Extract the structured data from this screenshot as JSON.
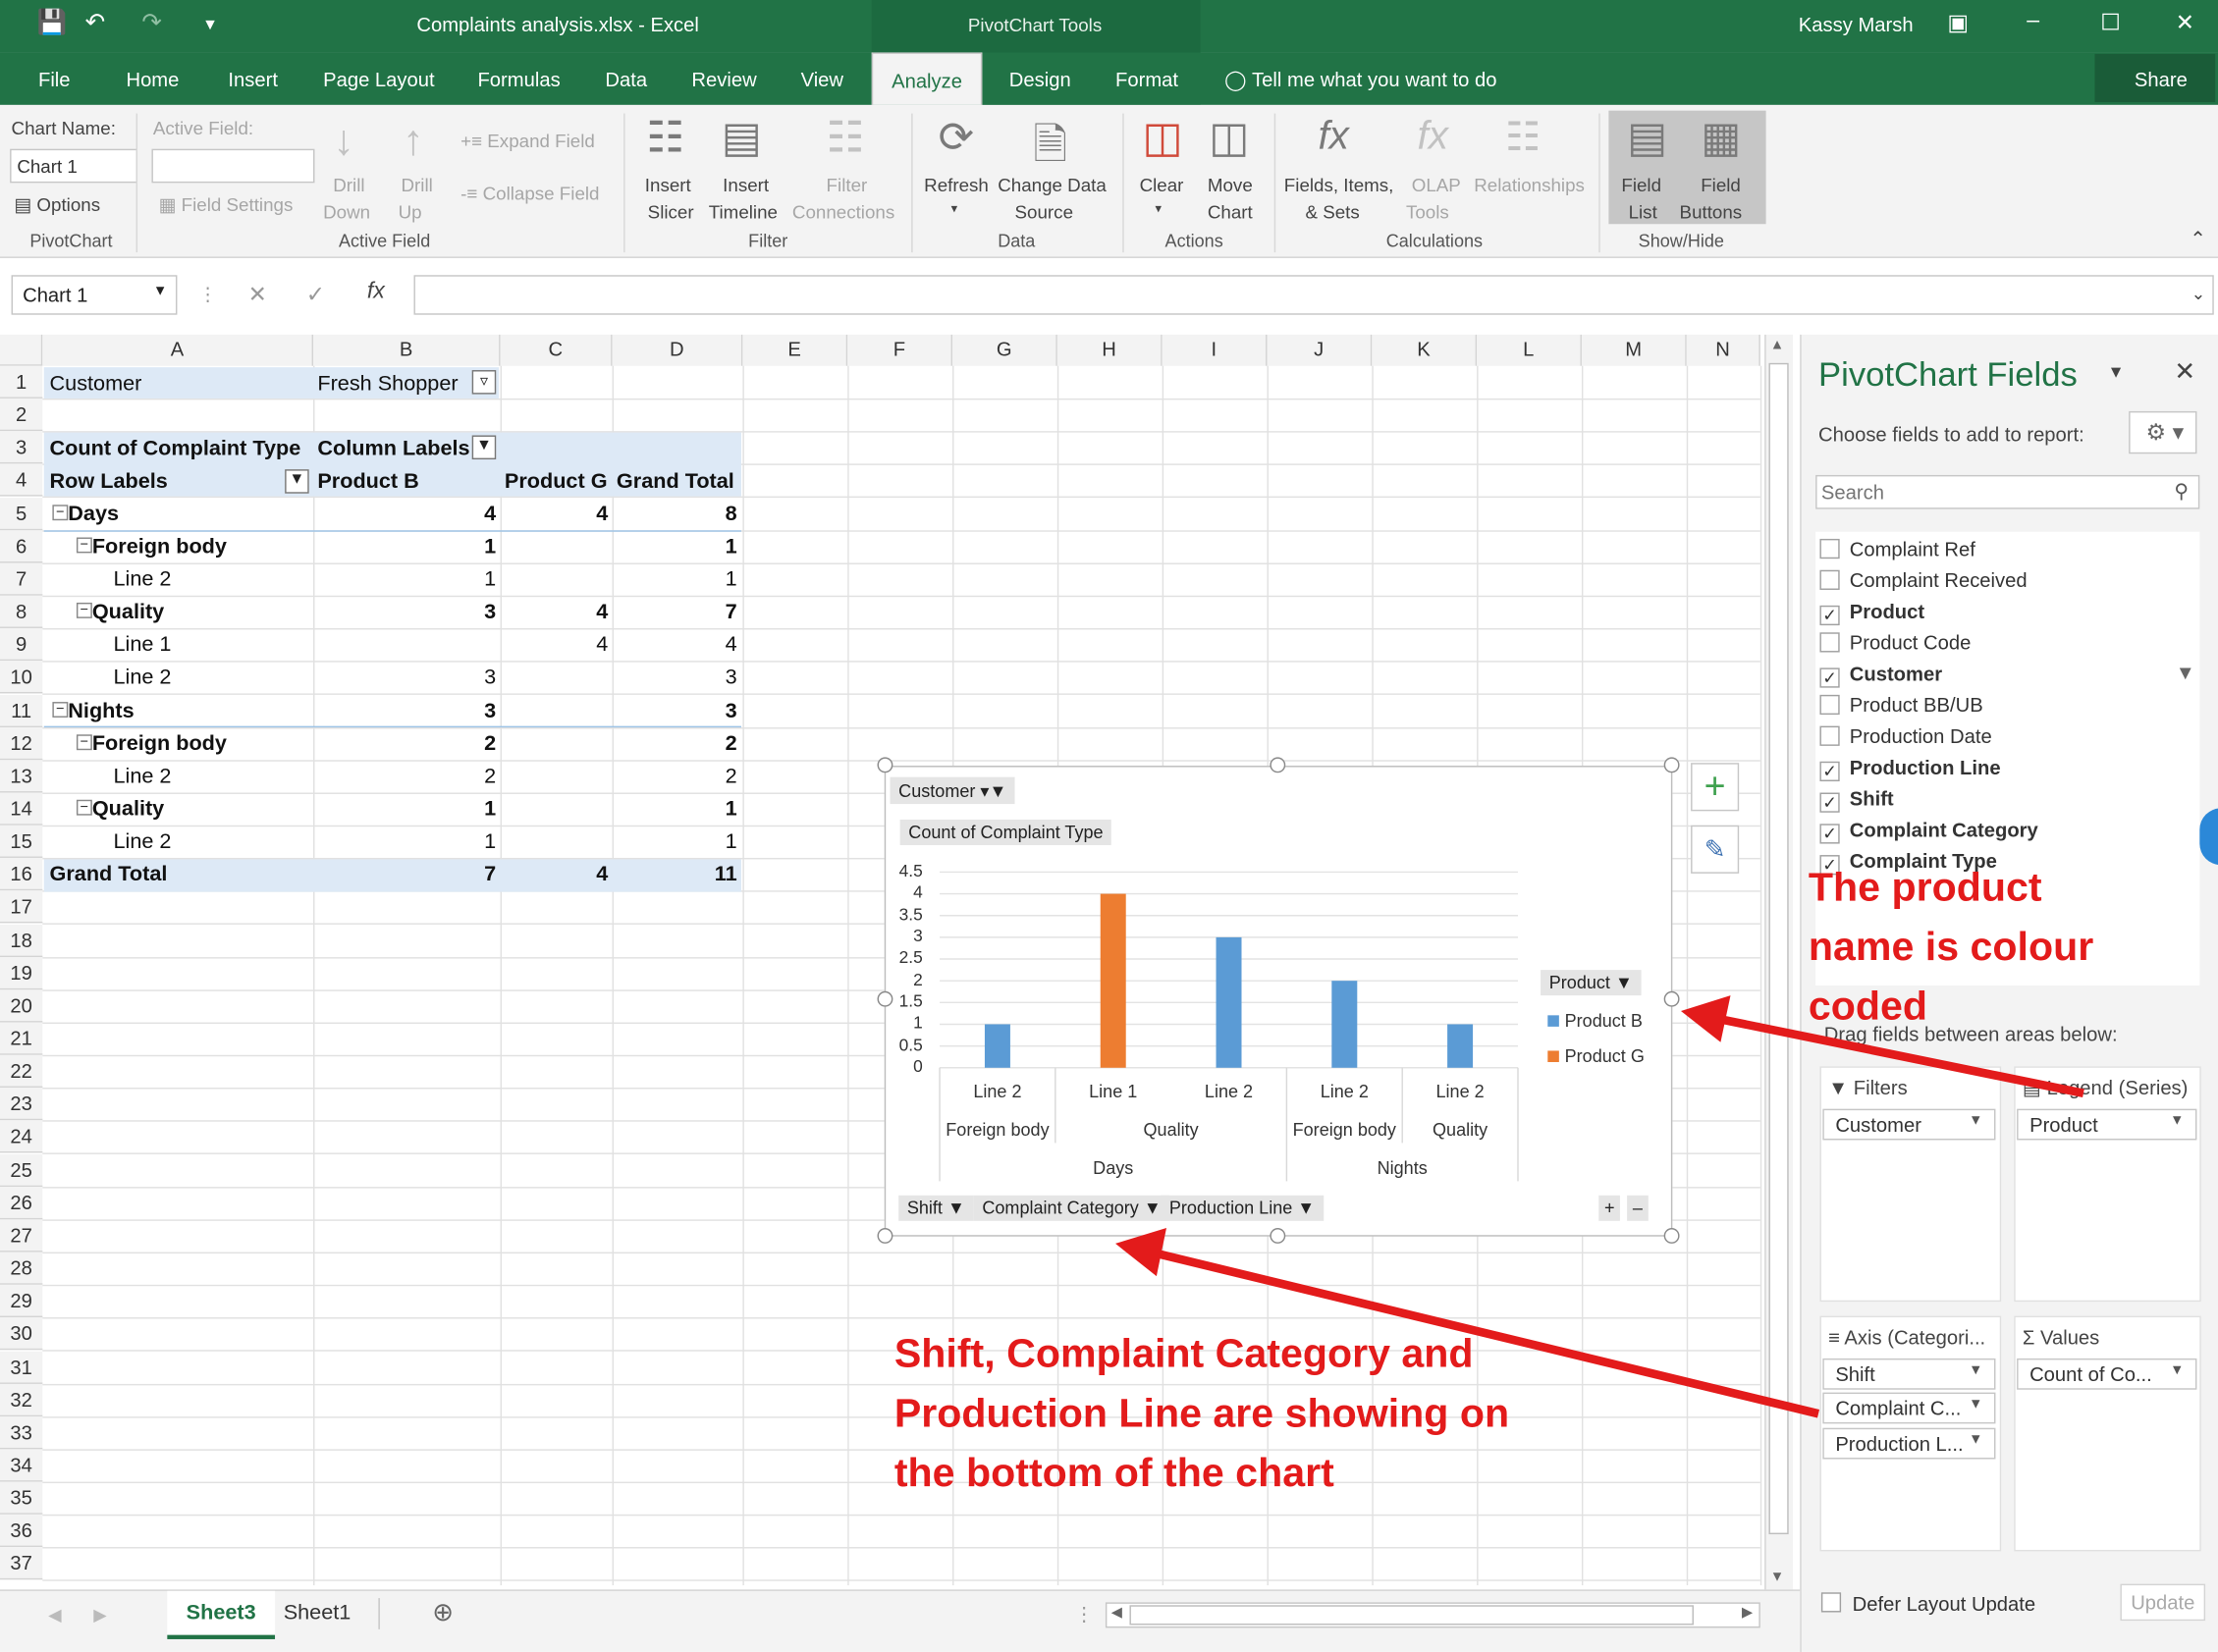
{
  "window": {
    "title": "Complaints analysis.xlsx - Excel",
    "context_tab": "PivotChart Tools",
    "user": "Kassy Marsh"
  },
  "tabs": [
    "File",
    "Home",
    "Insert",
    "Page Layout",
    "Formulas",
    "Data",
    "Review",
    "View",
    "Analyze",
    "Design",
    "Format"
  ],
  "tell_me": "Tell me what you want to do",
  "share": "Share",
  "ribbon": {
    "pivotchart": {
      "chart_name_label": "Chart Name:",
      "chart_name_value": "Chart 1",
      "options": "Options",
      "group": "PivotChart"
    },
    "active_field": {
      "label": "Active Field:",
      "field_settings": "Field Settings",
      "drill_down_1": "Drill",
      "drill_down_2": "Down",
      "drill_up_1": "Drill",
      "drill_up_2": "Up",
      "expand": "Expand Field",
      "collapse": "Collapse Field",
      "group": "Active Field"
    },
    "filter": {
      "insert_slicer_1": "Insert",
      "insert_slicer_2": "Slicer",
      "insert_timeline_1": "Insert",
      "insert_timeline_2": "Timeline",
      "filter_conn_1": "Filter",
      "filter_conn_2": "Connections",
      "group": "Filter"
    },
    "data": {
      "refresh": "Refresh",
      "change_1": "Change Data",
      "change_2": "Source",
      "group": "Data"
    },
    "actions": {
      "clear": "Clear",
      "move_1": "Move",
      "move_2": "Chart",
      "group": "Actions"
    },
    "calc": {
      "fields_1": "Fields, Items,",
      "fields_2": "& Sets",
      "olap_1": "OLAP",
      "olap_2": "Tools",
      "rel": "Relationships",
      "group": "Calculations"
    },
    "showhide": {
      "field_list_1": "Field",
      "field_list_2": "List",
      "field_buttons_1": "Field",
      "field_buttons_2": "Buttons",
      "group": "Show/Hide"
    }
  },
  "namebox": "Chart 1",
  "columns": [
    "A",
    "B",
    "C",
    "D",
    "E",
    "F",
    "G",
    "H",
    "I",
    "J",
    "K",
    "L",
    "M",
    "N"
  ],
  "rows": [
    "1",
    "2",
    "3",
    "4",
    "5",
    "6",
    "7",
    "8",
    "9",
    "10",
    "11",
    "12",
    "13",
    "14",
    "15",
    "16",
    "17",
    "18",
    "19",
    "20",
    "21",
    "22",
    "23",
    "24",
    "25",
    "26",
    "27",
    "28",
    "29",
    "30",
    "31",
    "32",
    "33",
    "34",
    "35",
    "36",
    "37"
  ],
  "pivot": {
    "filter_label": "Customer",
    "filter_value": "Fresh Shopper",
    "values_label": "Count of Complaint Type",
    "col_labels": "Column Labels",
    "row_labels": "Row Labels",
    "col1": "Product B",
    "col2": "Product G",
    "col3": "Grand Total",
    "r5": {
      "label": "Days",
      "b": "4",
      "g": "4",
      "t": "8"
    },
    "r6": {
      "label": "Foreign body",
      "b": "1",
      "g": "",
      "t": "1"
    },
    "r7": {
      "label": "Line 2",
      "b": "1",
      "g": "",
      "t": "1"
    },
    "r8": {
      "label": "Quality",
      "b": "3",
      "g": "4",
      "t": "7"
    },
    "r9": {
      "label": "Line 1",
      "b": "",
      "g": "4",
      "t": "4"
    },
    "r10": {
      "label": "Line 2",
      "b": "3",
      "g": "",
      "t": "3"
    },
    "r11": {
      "label": "Nights",
      "b": "3",
      "g": "",
      "t": "3"
    },
    "r12": {
      "label": "Foreign body",
      "b": "2",
      "g": "",
      "t": "2"
    },
    "r13": {
      "label": "Line 2",
      "b": "2",
      "g": "",
      "t": "2"
    },
    "r14": {
      "label": "Quality",
      "b": "1",
      "g": "",
      "t": "1"
    },
    "r15": {
      "label": "Line 2",
      "b": "1",
      "g": "",
      "t": "1"
    },
    "r16": {
      "label": "Grand Total",
      "b": "7",
      "g": "4",
      "t": "11"
    }
  },
  "chart_data": {
    "type": "bar",
    "filter_button": "Customer",
    "values_button": "Count of Complaint Type",
    "legend_button": "Product",
    "axis_buttons": [
      "Shift",
      "Complaint Category",
      "Production Line"
    ],
    "ylim": [
      0,
      4.5
    ],
    "yticks": [
      "0",
      "0.5",
      "1",
      "1.5",
      "2",
      "2.5",
      "3",
      "3.5",
      "4",
      "4.5"
    ],
    "categories": [
      "Line 2",
      "Line 1",
      "Line 2",
      "Line 2",
      "Line 2"
    ],
    "level2": [
      "Foreign body",
      "Quality",
      "Foreign body",
      "Quality"
    ],
    "level3": [
      "Days",
      "Nights"
    ],
    "series": [
      {
        "name": "Product B",
        "color": "#5b9bd5",
        "values": [
          1,
          null,
          3,
          2,
          1
        ]
      },
      {
        "name": "Product G",
        "color": "#ed7d31",
        "values": [
          null,
          4,
          null,
          null,
          null
        ]
      }
    ],
    "legend_position": "right"
  },
  "pane": {
    "title": "PivotChart Fields",
    "choose": "Choose fields to add to report:",
    "search_placeholder": "Search",
    "fields": [
      {
        "name": "Complaint Ref",
        "checked": false
      },
      {
        "name": "Complaint Received",
        "checked": false
      },
      {
        "name": "Product",
        "checked": true
      },
      {
        "name": "Product Code",
        "checked": false
      },
      {
        "name": "Customer",
        "checked": true
      },
      {
        "name": "Product BB/UB",
        "checked": false
      },
      {
        "name": "Production Date",
        "checked": false
      },
      {
        "name": "Production Line",
        "checked": true
      },
      {
        "name": "Shift",
        "checked": true
      },
      {
        "name": "Complaint Category",
        "checked": true
      },
      {
        "name": "Complaint Type",
        "checked": true
      }
    ],
    "drag": "Drag fields between areas below:",
    "filters": "Filters",
    "legend": "Legend (Series)",
    "axis": "Axis (Categori...",
    "values": "Values",
    "filters_items": [
      "Customer"
    ],
    "legend_items": [
      "Product"
    ],
    "axis_items": [
      "Shift",
      "Complaint C...",
      "Production L..."
    ],
    "values_items": [
      "Count of Co..."
    ],
    "defer": "Defer Layout Update",
    "update": "Update"
  },
  "sheet_tabs": [
    "Sheet3",
    "Sheet1"
  ],
  "annotations": {
    "product": [
      "The product",
      "name is colour",
      "coded"
    ],
    "shift": [
      "Shift, Complaint Category and",
      "Production Line are showing on",
      "the bottom of the chart"
    ]
  }
}
